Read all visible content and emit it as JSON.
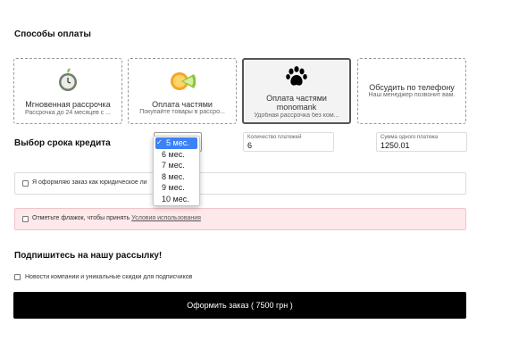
{
  "payment": {
    "title": "Способы оплаты",
    "options": [
      {
        "title": "Мгновенная рассрочка",
        "subtitle": "Рассрочка до 24 месяцев с ...",
        "icon": "clock-leaf-icon"
      },
      {
        "title": "Оплата частями",
        "subtitle": "Покупайте товары в рассро...",
        "icon": "orange-slice-icon"
      },
      {
        "title": "Оплата частями monomank",
        "subtitle": "Удобная рассрочка без ком...",
        "icon": "paw-icon",
        "selected": true
      },
      {
        "title": "Обсудить по телефону",
        "subtitle": "Наш менеджер позвонит вам.",
        "icon": ""
      }
    ]
  },
  "credit": {
    "title": "Выбор срока кредита",
    "term_options": [
      "5 мес.",
      "6 мес.",
      "7 мес.",
      "8 мес.",
      "9 мес.",
      "10 мес."
    ],
    "selected_term": "5 мес.",
    "count_label": "Количество платежей",
    "count_value": "6",
    "sum_label": "Сумма одного платежа",
    "sum_value": "1250.01"
  },
  "legal": {
    "label": "Я оформляю заказ как юридическое ли"
  },
  "terms": {
    "prefix": "Отметьте флажок, чтобы принять ",
    "link": "Условия использования"
  },
  "subscribe": {
    "title": "Подпишитесь на нашу рассылку!",
    "label": "Новости компании и уникальные скидки для подписчиков"
  },
  "order": {
    "label": "Оформить заказ ( 7500 грн )"
  },
  "colors": {
    "button": "#000000",
    "selection": "#3b82f6",
    "warning_bg": "#fde8ea"
  }
}
